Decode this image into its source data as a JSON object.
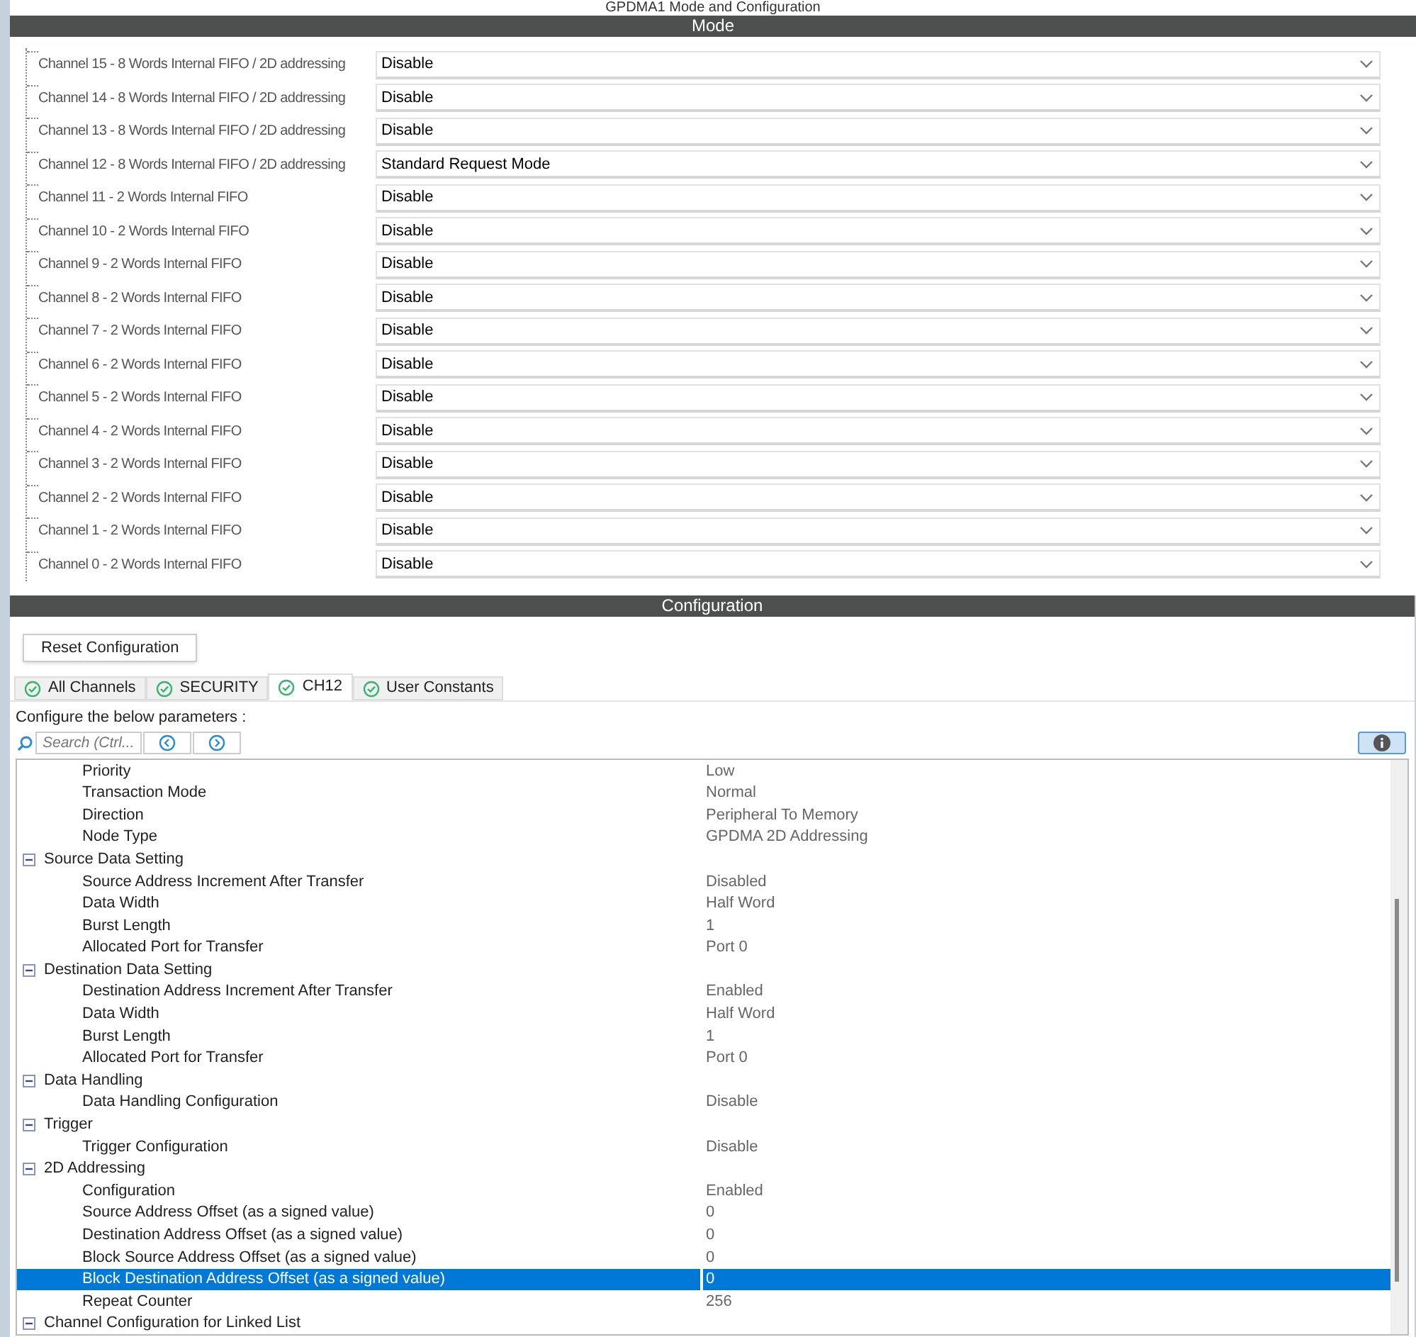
{
  "title": "GPDMA1 Mode and Configuration",
  "mode": {
    "header": "Mode",
    "channels": [
      {
        "label": "Channel 15 - 8 Words Internal FIFO / 2D addressing",
        "value": "Disable"
      },
      {
        "label": "Channel 14 - 8 Words Internal FIFO / 2D addressing",
        "value": "Disable"
      },
      {
        "label": "Channel 13 - 8 Words Internal FIFO / 2D addressing",
        "value": "Disable"
      },
      {
        "label": "Channel 12 - 8 Words Internal FIFO / 2D addressing",
        "value": "Standard Request Mode"
      },
      {
        "label": "Channel 11  - 2 Words Internal FIFO",
        "value": "Disable"
      },
      {
        "label": "Channel 10  - 2 Words Internal FIFO",
        "value": "Disable"
      },
      {
        "label": "Channel 9  - 2 Words Internal FIFO",
        "value": "Disable"
      },
      {
        "label": "Channel 8  - 2 Words Internal FIFO",
        "value": "Disable"
      },
      {
        "label": "Channel 7  - 2 Words Internal FIFO",
        "value": "Disable"
      },
      {
        "label": "Channel 6  - 2 Words Internal FIFO",
        "value": "Disable"
      },
      {
        "label": "Channel 5  - 2 Words Internal FIFO",
        "value": "Disable"
      },
      {
        "label": "Channel 4  - 2 Words Internal FIFO",
        "value": "Disable"
      },
      {
        "label": "Channel 3  - 2 Words Internal FIFO",
        "value": "Disable"
      },
      {
        "label": "Channel 2  - 2 Words Internal FIFO",
        "value": "Disable"
      },
      {
        "label": "Channel 1  - 2 Words Internal FIFO",
        "value": "Disable"
      },
      {
        "label": "Channel 0  - 2 Words Internal FIFO",
        "value": "Disable"
      }
    ]
  },
  "configuration": {
    "header": "Configuration",
    "reset_button": "Reset Configuration",
    "tabs": [
      {
        "label": "All Channels",
        "selected": false
      },
      {
        "label": "SECURITY",
        "selected": false
      },
      {
        "label": "CH12",
        "selected": true
      },
      {
        "label": "User Constants",
        "selected": false
      }
    ],
    "instruction": "Configure the below parameters :",
    "search": {
      "placeholder": "Search (Ctrl..."
    },
    "parameters": [
      {
        "kind": "param",
        "label": "Priority",
        "value": "Low",
        "selected": false
      },
      {
        "kind": "param",
        "label": "Transaction Mode",
        "value": "Normal",
        "selected": false
      },
      {
        "kind": "param",
        "label": "Direction",
        "value": "Peripheral To Memory",
        "selected": false
      },
      {
        "kind": "param",
        "label": "Node Type",
        "value": "GPDMA 2D Addressing",
        "selected": false
      },
      {
        "kind": "group",
        "label": "Source Data Setting",
        "expanded": true,
        "selected": false,
        "children": [
          {
            "kind": "param",
            "label": "Source Address Increment After Transfer",
            "value": "Disabled",
            "selected": false
          },
          {
            "kind": "param",
            "label": "Data Width",
            "value": "Half Word",
            "selected": false
          },
          {
            "kind": "param",
            "label": "Burst Length",
            "value": "1",
            "selected": false
          },
          {
            "kind": "param",
            "label": "Allocated Port for Transfer",
            "value": "Port 0",
            "selected": false
          }
        ]
      },
      {
        "kind": "group",
        "label": "Destination Data Setting",
        "expanded": true,
        "selected": false,
        "children": [
          {
            "kind": "param",
            "label": "Destination Address Increment After Transfer",
            "value": "Enabled",
            "selected": false
          },
          {
            "kind": "param",
            "label": "Data Width",
            "value": "Half Word",
            "selected": false
          },
          {
            "kind": "param",
            "label": "Burst Length",
            "value": "1",
            "selected": false
          },
          {
            "kind": "param",
            "label": "Allocated Port for Transfer",
            "value": "Port 0",
            "selected": false
          }
        ]
      },
      {
        "kind": "group",
        "label": "Data Handling",
        "expanded": true,
        "selected": false,
        "children": [
          {
            "kind": "param",
            "label": "Data Handling Configuration",
            "value": "Disable",
            "selected": false
          }
        ]
      },
      {
        "kind": "group",
        "label": "Trigger",
        "expanded": true,
        "selected": false,
        "children": [
          {
            "kind": "param",
            "label": "Trigger Configuration",
            "value": "Disable",
            "selected": false
          }
        ]
      },
      {
        "kind": "group",
        "label": "2D Addressing",
        "expanded": true,
        "selected": false,
        "children": [
          {
            "kind": "param",
            "label": "Configuration",
            "value": "Enabled",
            "selected": false
          },
          {
            "kind": "param",
            "label": "Source Address Offset (as a signed value)",
            "value": "0",
            "selected": false
          },
          {
            "kind": "param",
            "label": "Destination Address Offset (as a signed value)",
            "value": "0",
            "selected": false
          },
          {
            "kind": "param",
            "label": "Block Source Address Offset (as a signed value)",
            "value": "0",
            "selected": false
          },
          {
            "kind": "param",
            "label": "Block Destination Address Offset (as a signed value)",
            "value": "0",
            "selected": true
          },
          {
            "kind": "param",
            "label": "Repeat Counter",
            "value": "256",
            "selected": false
          }
        ]
      },
      {
        "kind": "group",
        "label": "Channel Configuration for Linked List",
        "expanded": true,
        "selected": false
      }
    ]
  }
}
